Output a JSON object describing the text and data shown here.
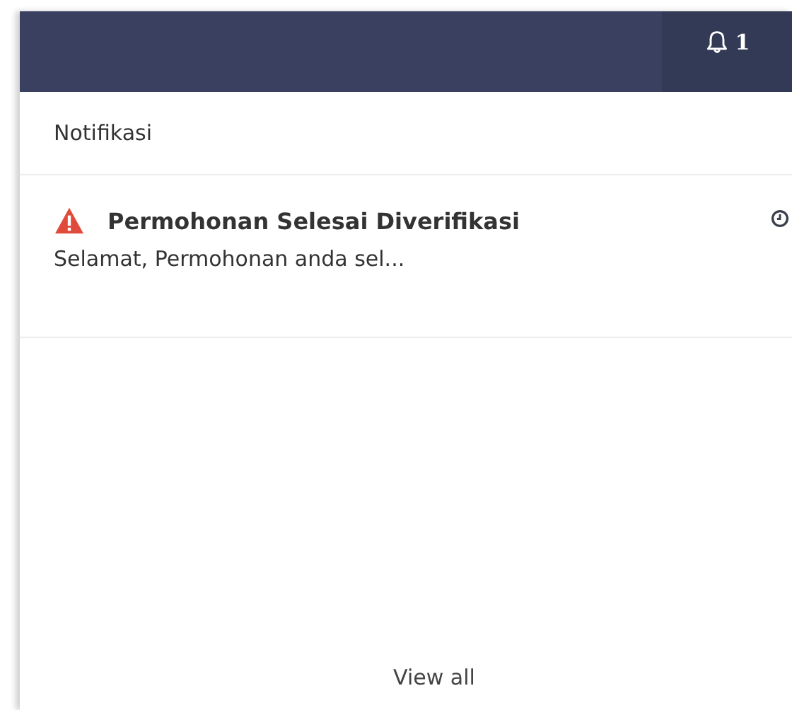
{
  "top_bar": {
    "notification_count": "1"
  },
  "panel": {
    "title": "Notifikasi",
    "notifications": [
      {
        "kind": "warning",
        "title": "Permohonan Selesai Diverifikasi",
        "preview": "Selamat, Permohonan anda sel..."
      }
    ],
    "footer_link": "View all"
  }
}
